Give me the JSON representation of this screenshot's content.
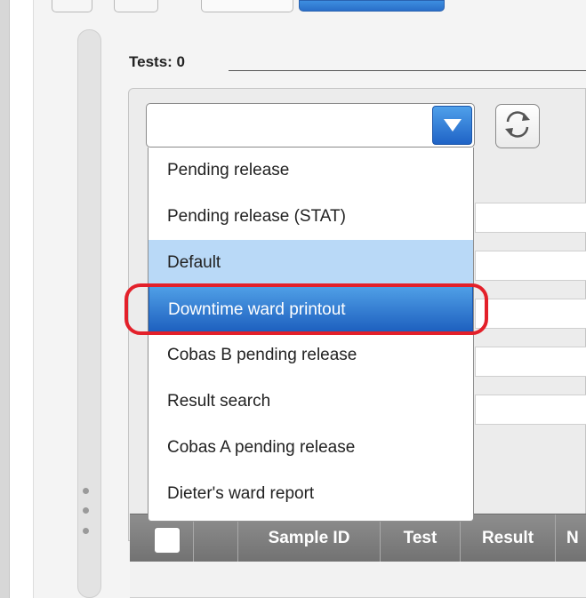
{
  "tests": {
    "label": "Tests:",
    "count": "0"
  },
  "filter_dropdown": {
    "current_value": "",
    "options": [
      "Pending release",
      "Pending release (STAT)",
      "Default",
      "Downtime ward printout",
      "Cobas B pending release",
      "Result search",
      "Cobas A pending release",
      "Dieter's ward report"
    ],
    "hovered_option": "Default",
    "selected_option": "Downtime ward printout"
  },
  "icons": {
    "dropdown_toggle": "chevron-down-icon",
    "refresh": "refresh-icon",
    "sidebar_grip": "grip-dots-icon"
  },
  "table": {
    "columns": [
      "",
      "Sample ID",
      "Test",
      "Result",
      "N"
    ]
  },
  "colors": {
    "accent_blue": "#2a6fc9",
    "hover_blue": "#b9d9f7",
    "highlight_red": "#e3202a",
    "header_gray": "#7f7f7f"
  }
}
